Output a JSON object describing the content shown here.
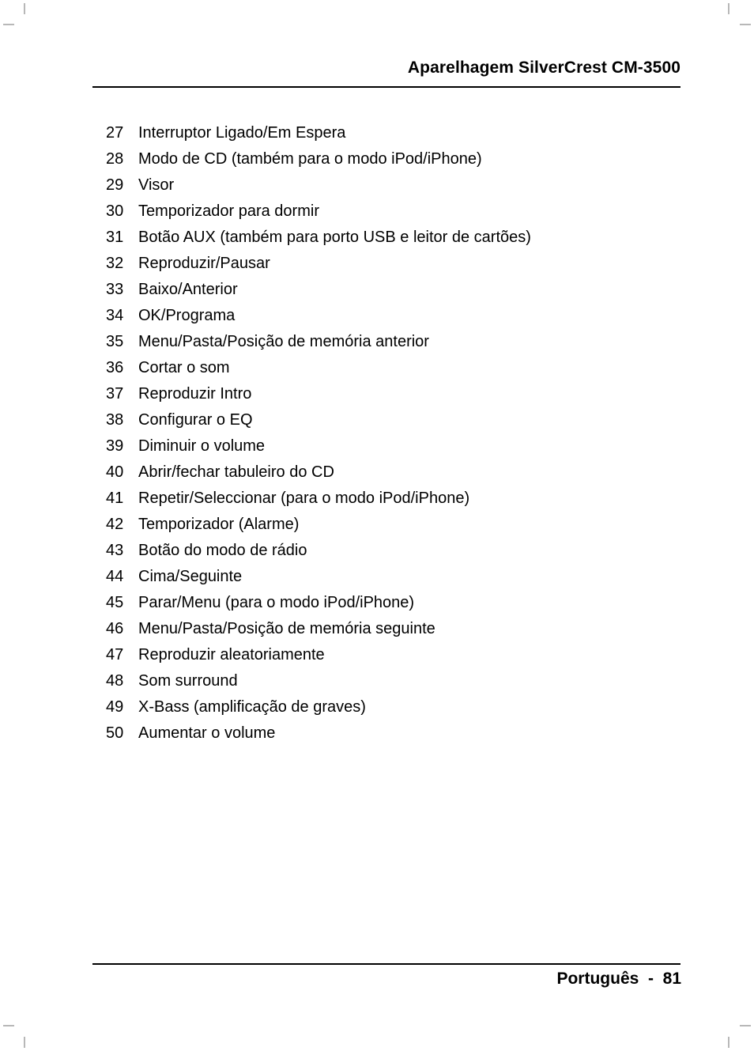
{
  "header": {
    "title": "Aparelhagem SilverCrest CM-3500"
  },
  "main": {
    "items": [
      {
        "number": "27",
        "label": "Interruptor Ligado/Em Espera"
      },
      {
        "number": "28",
        "label": "Modo de CD (também para o modo iPod/iPhone)"
      },
      {
        "number": "29",
        "label": "Visor"
      },
      {
        "number": "30",
        "label": "Temporizador para dormir"
      },
      {
        "number": "31",
        "label": "Botão AUX (também para porto USB e leitor de cartões)"
      },
      {
        "number": "32",
        "label": "Reproduzir/Pausar"
      },
      {
        "number": "33",
        "label": "Baixo/Anterior"
      },
      {
        "number": "34",
        "label": "OK/Programa"
      },
      {
        "number": "35",
        "label": "Menu/Pasta/Posição de memória anterior"
      },
      {
        "number": "36",
        "label": "Cortar o som"
      },
      {
        "number": "37",
        "label": "Reproduzir Intro"
      },
      {
        "number": "38",
        "label": "Configurar o EQ"
      },
      {
        "number": "39",
        "label": "Diminuir o volume"
      },
      {
        "number": "40",
        "label": "Abrir/fechar tabuleiro do CD"
      },
      {
        "number": "41",
        "label": "Repetir/Seleccionar (para o modo iPod/iPhone)"
      },
      {
        "number": "42",
        "label": "Temporizador (Alarme)"
      },
      {
        "number": "43",
        "label": "Botão do modo de rádio"
      },
      {
        "number": "44",
        "label": "Cima/Seguinte"
      },
      {
        "number": "45",
        "label": "Parar/Menu (para o modo iPod/iPhone)"
      },
      {
        "number": "46",
        "label": "Menu/Pasta/Posição de memória seguinte"
      },
      {
        "number": "47",
        "label": "Reproduzir aleatoriamente"
      },
      {
        "number": "48",
        "label": "Som surround"
      },
      {
        "number": "49",
        "label": "X-Bass (amplificação de graves)"
      },
      {
        "number": "50",
        "label": "Aumentar o volume"
      }
    ]
  },
  "footer": {
    "language": "Português",
    "separator": "-",
    "page_number": "81",
    "text": "Português  -  81"
  }
}
